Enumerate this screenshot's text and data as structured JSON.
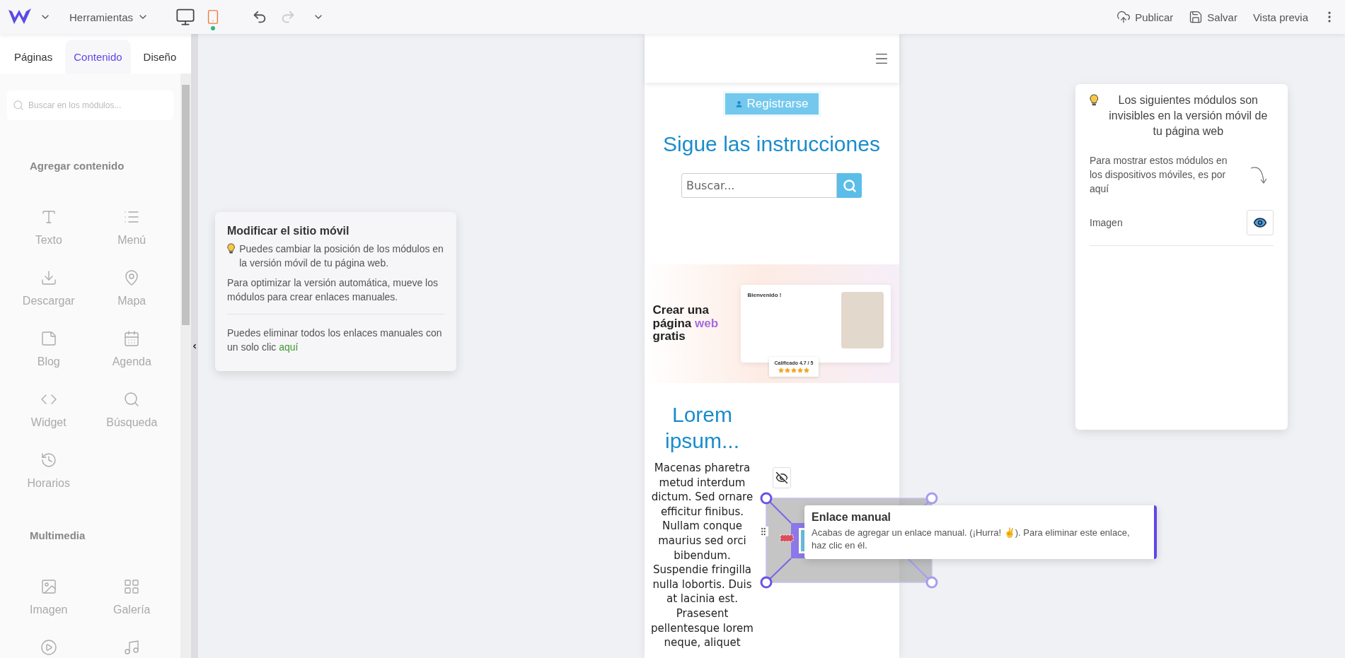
{
  "toolbar": {
    "tools_label": "Herramientas",
    "devices": [
      {
        "kind": "desktop",
        "selected": false
      },
      {
        "kind": "mobile",
        "selected": true
      }
    ],
    "undo": {
      "disabled": false
    },
    "redo": {
      "disabled": true
    },
    "actions": [
      {
        "kind": "publish",
        "label": "Publicar"
      },
      {
        "kind": "save",
        "label": "Salvar"
      },
      {
        "kind": "preview",
        "label": "Vista previa"
      }
    ]
  },
  "sidebar": {
    "tabs": [
      {
        "label": "Páginas",
        "selected": false
      },
      {
        "label": "Contenido",
        "selected": true
      },
      {
        "label": "Diseño",
        "selected": false
      }
    ],
    "search": {
      "placeholder": "Buscar en los módulos..."
    },
    "sections": [
      {
        "title": "Agregar contenido",
        "items": [
          {
            "label": "Texto"
          },
          {
            "label": "Menú"
          },
          {
            "label": "Descargar"
          },
          {
            "label": "Mapa"
          },
          {
            "label": "Blog"
          },
          {
            "label": "Agenda"
          },
          {
            "label": "Widget"
          },
          {
            "label": "Búsqueda"
          },
          {
            "label": "Horarios"
          }
        ]
      },
      {
        "title": "Multimedia",
        "items": [
          {
            "label": "Imagen"
          },
          {
            "label": "Galería"
          }
        ]
      }
    ]
  },
  "tip_card": {
    "title": "Modificar el sitio móvil",
    "tip": "Puedes cambiar la posición de los módulos en la versión móvil de tu página web.",
    "text": "Para optimizar la versión automática, mueve los módulos para crear enlaces manuales.",
    "footer": "Puedes eliminar todos los enlaces manuales con un solo clic",
    "link": "aquí"
  },
  "phone": {
    "register_button": "Registrarse",
    "heading": "Sigue las instrucciones",
    "search": {
      "placeholder": "Buscar..."
    },
    "image": {
      "headline": "Crear una página",
      "headline_accent": "web",
      "headline_end": "gratis",
      "welcome": "Bienvenido !",
      "rating": "Calificado 4.7 / 5",
      "stars": 5
    },
    "lorem_heading": "Lorem ipsum...",
    "paragraph": "Macenas pharetra metud interdum dictum. Sed ornare efficitur finibus. Nullam conque maurius sed orci bibendum. Suspendie fringilla nulla lobortis. Duis at lacinia est. Prasesent pellentesque lorem neque, aliquet"
  },
  "manual_link_tip": {
    "title": "Enlace manual",
    "text": "Acabas de agregar un enlace manual. (¡Hurra! ✌). Para eliminar este enlace, haz clic en él."
  },
  "hidden_panel": {
    "title": "Los siguientes módulos son invisibles en la versión móvil de tu página web",
    "hint": "Para mostrar estos módulos en los dispositivos móviles, es por aquí",
    "modules": [
      {
        "label": "Imagen"
      }
    ]
  }
}
